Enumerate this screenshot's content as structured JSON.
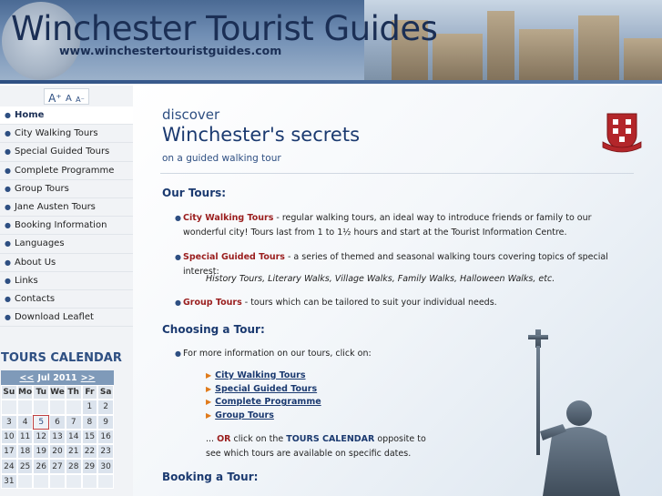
{
  "header": {
    "title": "Winchester Tourist Guides",
    "url": "www.winchestertouristguides.com"
  },
  "font_sizer": {
    "large": "A⁺",
    "normal": "A",
    "small": "A⁻"
  },
  "sidebar": {
    "items": [
      {
        "label": "Home"
      },
      {
        "label": "City Walking Tours"
      },
      {
        "label": "Special Guided Tours"
      },
      {
        "label": "Complete Programme"
      },
      {
        "label": "Group Tours"
      },
      {
        "label": "Jane Austen Tours"
      },
      {
        "label": "Booking Information"
      },
      {
        "label": "Languages"
      },
      {
        "label": "About Us"
      },
      {
        "label": "Links"
      },
      {
        "label": "Contacts"
      },
      {
        "label": "Download Leaflet"
      }
    ]
  },
  "calendar": {
    "title": "TOURS CALENDAR",
    "prev": "<<",
    "month": "Jul 2011",
    "next": ">>",
    "days_of_week": [
      "Su",
      "Mo",
      "Tu",
      "We",
      "Th",
      "Fr",
      "Sa"
    ],
    "weeks": [
      [
        "",
        "",
        "",
        "",
        "",
        "1",
        "2"
      ],
      [
        "3",
        "4",
        "5",
        "6",
        "7",
        "8",
        "9"
      ],
      [
        "10",
        "11",
        "12",
        "13",
        "14",
        "15",
        "16"
      ],
      [
        "17",
        "18",
        "19",
        "20",
        "21",
        "22",
        "23"
      ],
      [
        "24",
        "25",
        "26",
        "27",
        "28",
        "29",
        "30"
      ],
      [
        "31",
        "",
        "",
        "",
        "",
        "",
        ""
      ]
    ],
    "today": "5"
  },
  "main": {
    "discover": "discover",
    "headline": "Winchester's secrets",
    "tagline": "on a guided walking tour",
    "our_tours_heading": "Our Tours:",
    "tours": [
      {
        "name": "City Walking Tours",
        "desc": " - regular walking tours, an ideal way to introduce friends or family to our wonderful city! Tours last from 1 to 1½ hours and start at the Tourist Information Centre."
      },
      {
        "name": "Special Guided Tours",
        "desc": " - a series of themed and seasonal walking tours covering topics of special interest:"
      },
      {
        "name": "Group Tours",
        "desc": " - tours which can be tailored to suit your individual needs."
      }
    ],
    "special_examples": "History Tours, Literary Walks, Village Walks, Family Walks, Halloween Walks, etc.",
    "choosing_heading": "Choosing a Tour:",
    "choosing_intro": "For more information on our tours, click on:",
    "choosing_links": [
      {
        "label": "City Walking Tours"
      },
      {
        "label": "Special Guided Tours"
      },
      {
        "label": "Complete Programme"
      },
      {
        "label": "Group Tours"
      }
    ],
    "or_prefix": "... ",
    "or_word": "OR",
    "or_mid": " click on the ",
    "or_cal": "TOURS CALENDAR",
    "or_suffix": " opposite to see which tours are available on specific dates.",
    "booking_heading": "Booking a Tour:"
  },
  "colors": {
    "brand_navy": "#1b3a70",
    "accent_red": "#9a1e1e",
    "link_arrow": "#e07a1a"
  }
}
